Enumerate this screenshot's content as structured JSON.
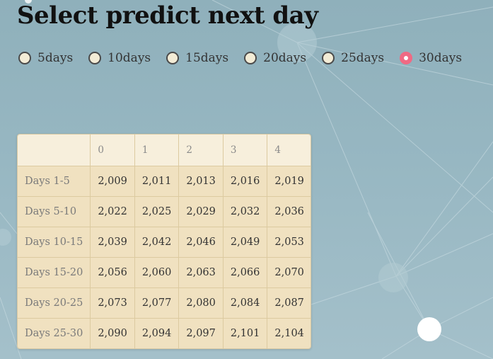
{
  "page": {
    "title": "Select predict next day"
  },
  "radio": {
    "options": [
      {
        "label": "5days",
        "selected": false
      },
      {
        "label": "10days",
        "selected": false
      },
      {
        "label": "15days",
        "selected": false
      },
      {
        "label": "20days",
        "selected": false
      },
      {
        "label": "25days",
        "selected": false
      },
      {
        "label": "30days",
        "selected": true
      }
    ],
    "selected_color": "#f06a84"
  },
  "table": {
    "columns": [
      "",
      "0",
      "1",
      "2",
      "3",
      "4"
    ],
    "rows": [
      {
        "label": "Days 1-5",
        "values": [
          "2,009",
          "2,011",
          "2,013",
          "2,016",
          "2,019"
        ]
      },
      {
        "label": "Days 5-10",
        "values": [
          "2,022",
          "2,025",
          "2,029",
          "2,032",
          "2,036"
        ]
      },
      {
        "label": "Days 10-15",
        "values": [
          "2,039",
          "2,042",
          "2,046",
          "2,049",
          "2,053"
        ]
      },
      {
        "label": "Days 15-20",
        "values": [
          "2,056",
          "2,060",
          "2,063",
          "2,066",
          "2,070"
        ]
      },
      {
        "label": "Days 20-25",
        "values": [
          "2,073",
          "2,077",
          "2,080",
          "2,084",
          "2,087"
        ]
      },
      {
        "label": "Days 25-30",
        "values": [
          "2,090",
          "2,094",
          "2,097",
          "2,101",
          "2,104"
        ]
      }
    ]
  }
}
